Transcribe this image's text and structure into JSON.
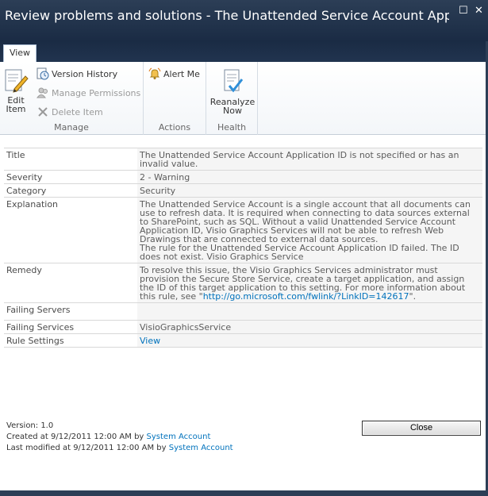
{
  "window": {
    "title": "Review problems and solutions - The Unattended Service Account Applicatio...",
    "maximize_glyph": "☐",
    "close_glyph": "✕"
  },
  "ribbon": {
    "tab": "View",
    "groups": {
      "manage": {
        "label": "Manage",
        "edit_item": "Edit Item",
        "edit_item_line1": "Edit",
        "edit_item_line2": "Item",
        "version_history": "Version History",
        "manage_permissions": "Manage Permissions",
        "delete_item": "Delete Item"
      },
      "actions": {
        "label": "Actions",
        "alert_me": "Alert Me"
      },
      "health": {
        "label": "Health",
        "reanalyze_line1": "Reanalyze",
        "reanalyze_line2": "Now"
      }
    },
    "icons": {
      "edit": "edit-item-icon",
      "version": "version-history-icon",
      "permissions": "manage-permissions-icon",
      "delete": "delete-item-icon",
      "alert": "alert-me-icon",
      "reanalyze": "reanalyze-now-icon"
    }
  },
  "properties": {
    "title": {
      "label": "Title",
      "value": "The Unattended Service Account Application ID is not specified or has an invalid value."
    },
    "severity": {
      "label": "Severity",
      "value": "2 - Warning"
    },
    "category": {
      "label": "Category",
      "value": "Security"
    },
    "explanation": {
      "label": "Explanation",
      "value_p1": "The Unattended Service Account is a single account that all documents can use to refresh data. It is required when connecting to data sources external to SharePoint, such as SQL. Without a valid Unattended Service Account Application ID, Visio Graphics Services will not be able to refresh Web Drawings that are connected to external data sources.",
      "value_p2": "The rule for the Unattended Service Account Application ID failed. The ID does not exist. Visio Graphics Service"
    },
    "remedy": {
      "label": "Remedy",
      "value_prefix": "To resolve this issue, the Visio Graphics Services administrator must provision the Secure Store Service, create a target application, and assign the ID of this target application to this setting. For more information about this rule, see \"",
      "link": "http://go.microsoft.com/fwlink/?LinkID=142617",
      "value_suffix": "\"."
    },
    "failing_servers": {
      "label": "Failing Servers",
      "value": ""
    },
    "failing_services": {
      "label": "Failing Services",
      "value": "VisioGraphicsService"
    },
    "rule_settings": {
      "label": "Rule Settings",
      "link": "View"
    }
  },
  "footer": {
    "version": "Version: 1.0",
    "created_prefix": "Created at 9/12/2011 12:00 AM  by ",
    "created_by": "System Account",
    "modified_prefix": "Last modified at 9/12/2011 12:00 AM  by ",
    "modified_by": "System Account"
  },
  "buttons": {
    "close": "Close"
  },
  "colors": {
    "titlebar": "#1a2b44",
    "link": "#0072bc",
    "value_bg": "#f5f5f5"
  }
}
